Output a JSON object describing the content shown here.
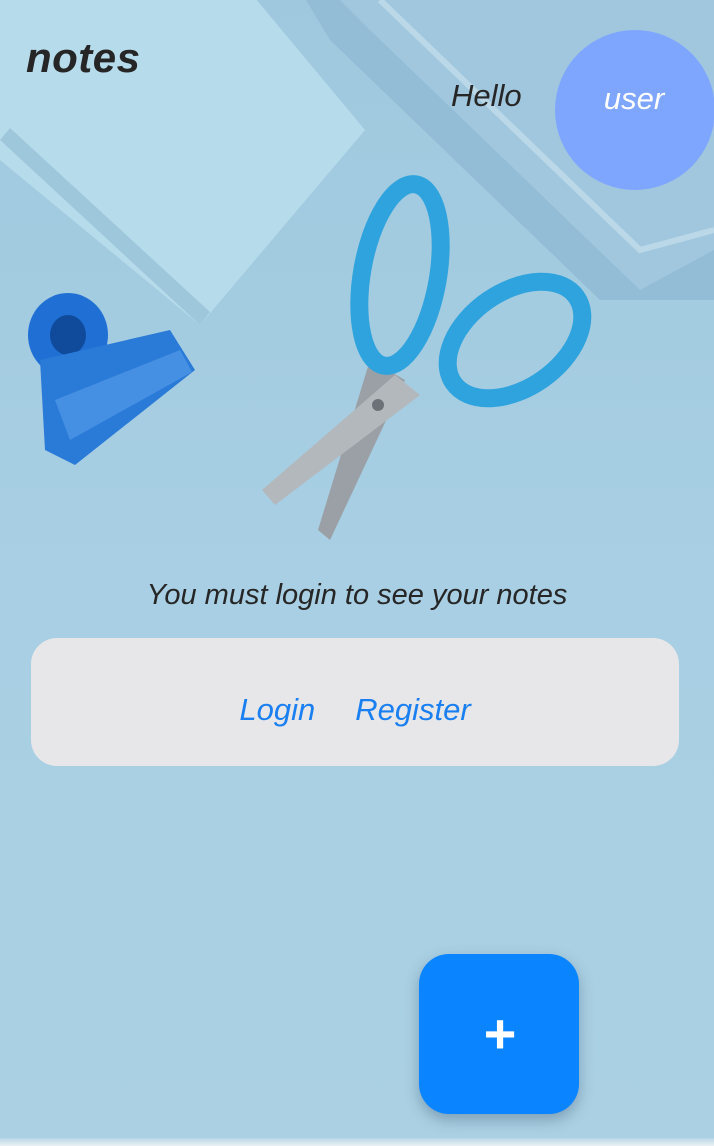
{
  "header": {
    "app_title": "notes",
    "greeting": "Hello",
    "user_label": "user"
  },
  "main": {
    "login_message": "You must login to see your notes",
    "login_label": "Login",
    "register_label": "Register"
  },
  "fab": {
    "icon": "plus-icon",
    "symbol": "+"
  },
  "colors": {
    "background": "#a9cfe3",
    "avatar": "#7fa6ff",
    "accent": "#0a84ff",
    "link": "#1a7ff0",
    "card": "#e7e7e9",
    "text": "#262626"
  }
}
